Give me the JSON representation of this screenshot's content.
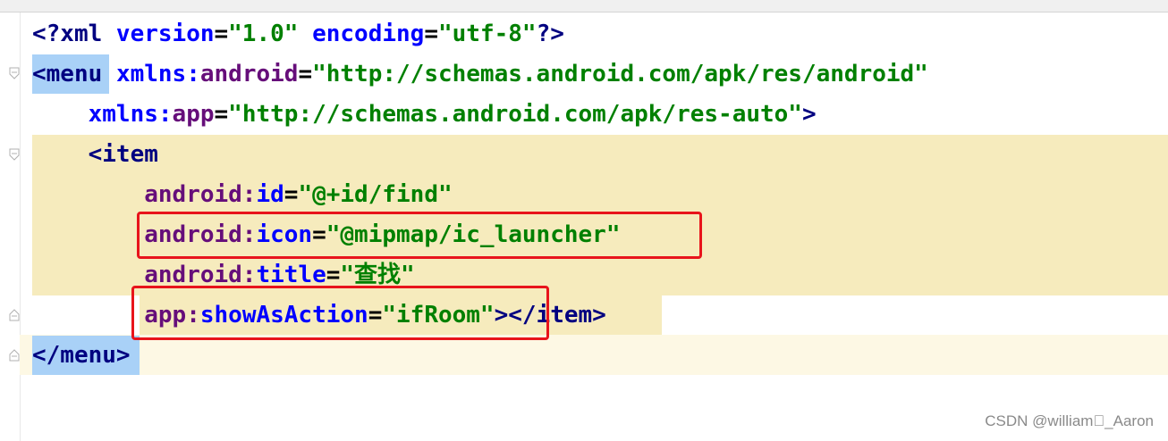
{
  "editor": {
    "lines": [
      {
        "parts": [
          "<?xml ",
          "version",
          "=",
          "\"1.0\"",
          " ",
          "encoding",
          "=",
          "\"utf-8\"",
          "?>"
        ]
      },
      {
        "parts": [
          "<menu",
          " ",
          "xmlns:",
          "android",
          "=",
          "\"http://schemas.android.com/apk/res/android\""
        ]
      },
      {
        "parts": [
          "    ",
          "xmlns:",
          "app",
          "=",
          "\"http://schemas.android.com/apk/res-auto\"",
          ">"
        ]
      },
      {
        "parts": [
          "    ",
          "<item"
        ]
      },
      {
        "parts": [
          "        ",
          "android:",
          "id",
          "=",
          "\"@+id/find\""
        ]
      },
      {
        "parts": [
          "        ",
          "android:",
          "icon",
          "=",
          "\"@mipmap/ic_launcher\""
        ]
      },
      {
        "parts": [
          "        ",
          "android:",
          "title",
          "=",
          "\"查找\""
        ]
      },
      {
        "parts": [
          "        ",
          "app:",
          "showAsAction",
          "=",
          "\"ifRoom\"",
          "></item>"
        ]
      },
      {
        "parts": [
          "</menu>"
        ]
      }
    ]
  },
  "watermark": "CSDN @william\u0000_Aaron",
  "colors": {
    "tag": "#000080",
    "attribute": "#0000ff",
    "namespace": "#660e7a",
    "string": "#008000",
    "highlight": "#f6ebbd",
    "tag_match": "#a9d1f7",
    "annotation_box": "#e8141b"
  }
}
